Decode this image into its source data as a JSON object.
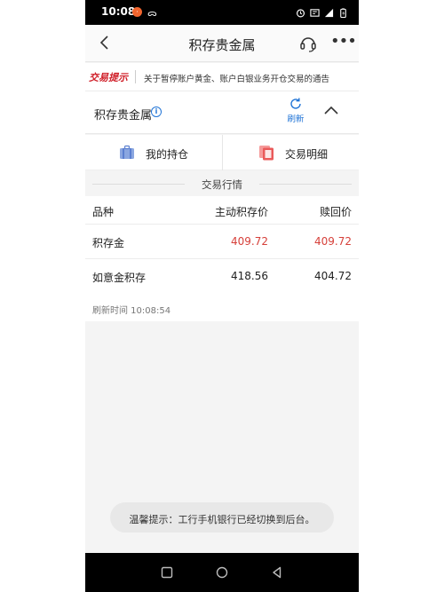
{
  "status_bar": {
    "time": "10:08",
    "app_badge": "·",
    "wechat": "ᯅ"
  },
  "header": {
    "title": "积存贵金属"
  },
  "notice": {
    "tag": "交易提示",
    "text": "关于暂停账户黄金、账户白银业务开仓交易的通告"
  },
  "product": {
    "name": "积存贵金属",
    "info_symbol": "i",
    "refresh_label": "刷新"
  },
  "tabs": [
    {
      "label": "我的持仓",
      "icon": "briefcase-icon"
    },
    {
      "label": "交易明细",
      "icon": "documents-icon"
    }
  ],
  "market": {
    "title": "交易行情",
    "columns": [
      "品种",
      "主动积存价",
      "赎回价"
    ],
    "rows": [
      {
        "name": "积存金",
        "buy": "409.72",
        "redeem": "409.72",
        "highlight": true
      },
      {
        "name": "如意金积存",
        "buy": "418.56",
        "redeem": "404.72",
        "highlight": false
      }
    ],
    "refresh_time": "刷新时间 10:08:54"
  },
  "toast": {
    "text": "温馨提示：工行手机银行已经切换到后台。"
  },
  "colors": {
    "accent_blue": "#1f73d6",
    "price_red": "#d6403a",
    "notice_red": "#d0202a"
  }
}
